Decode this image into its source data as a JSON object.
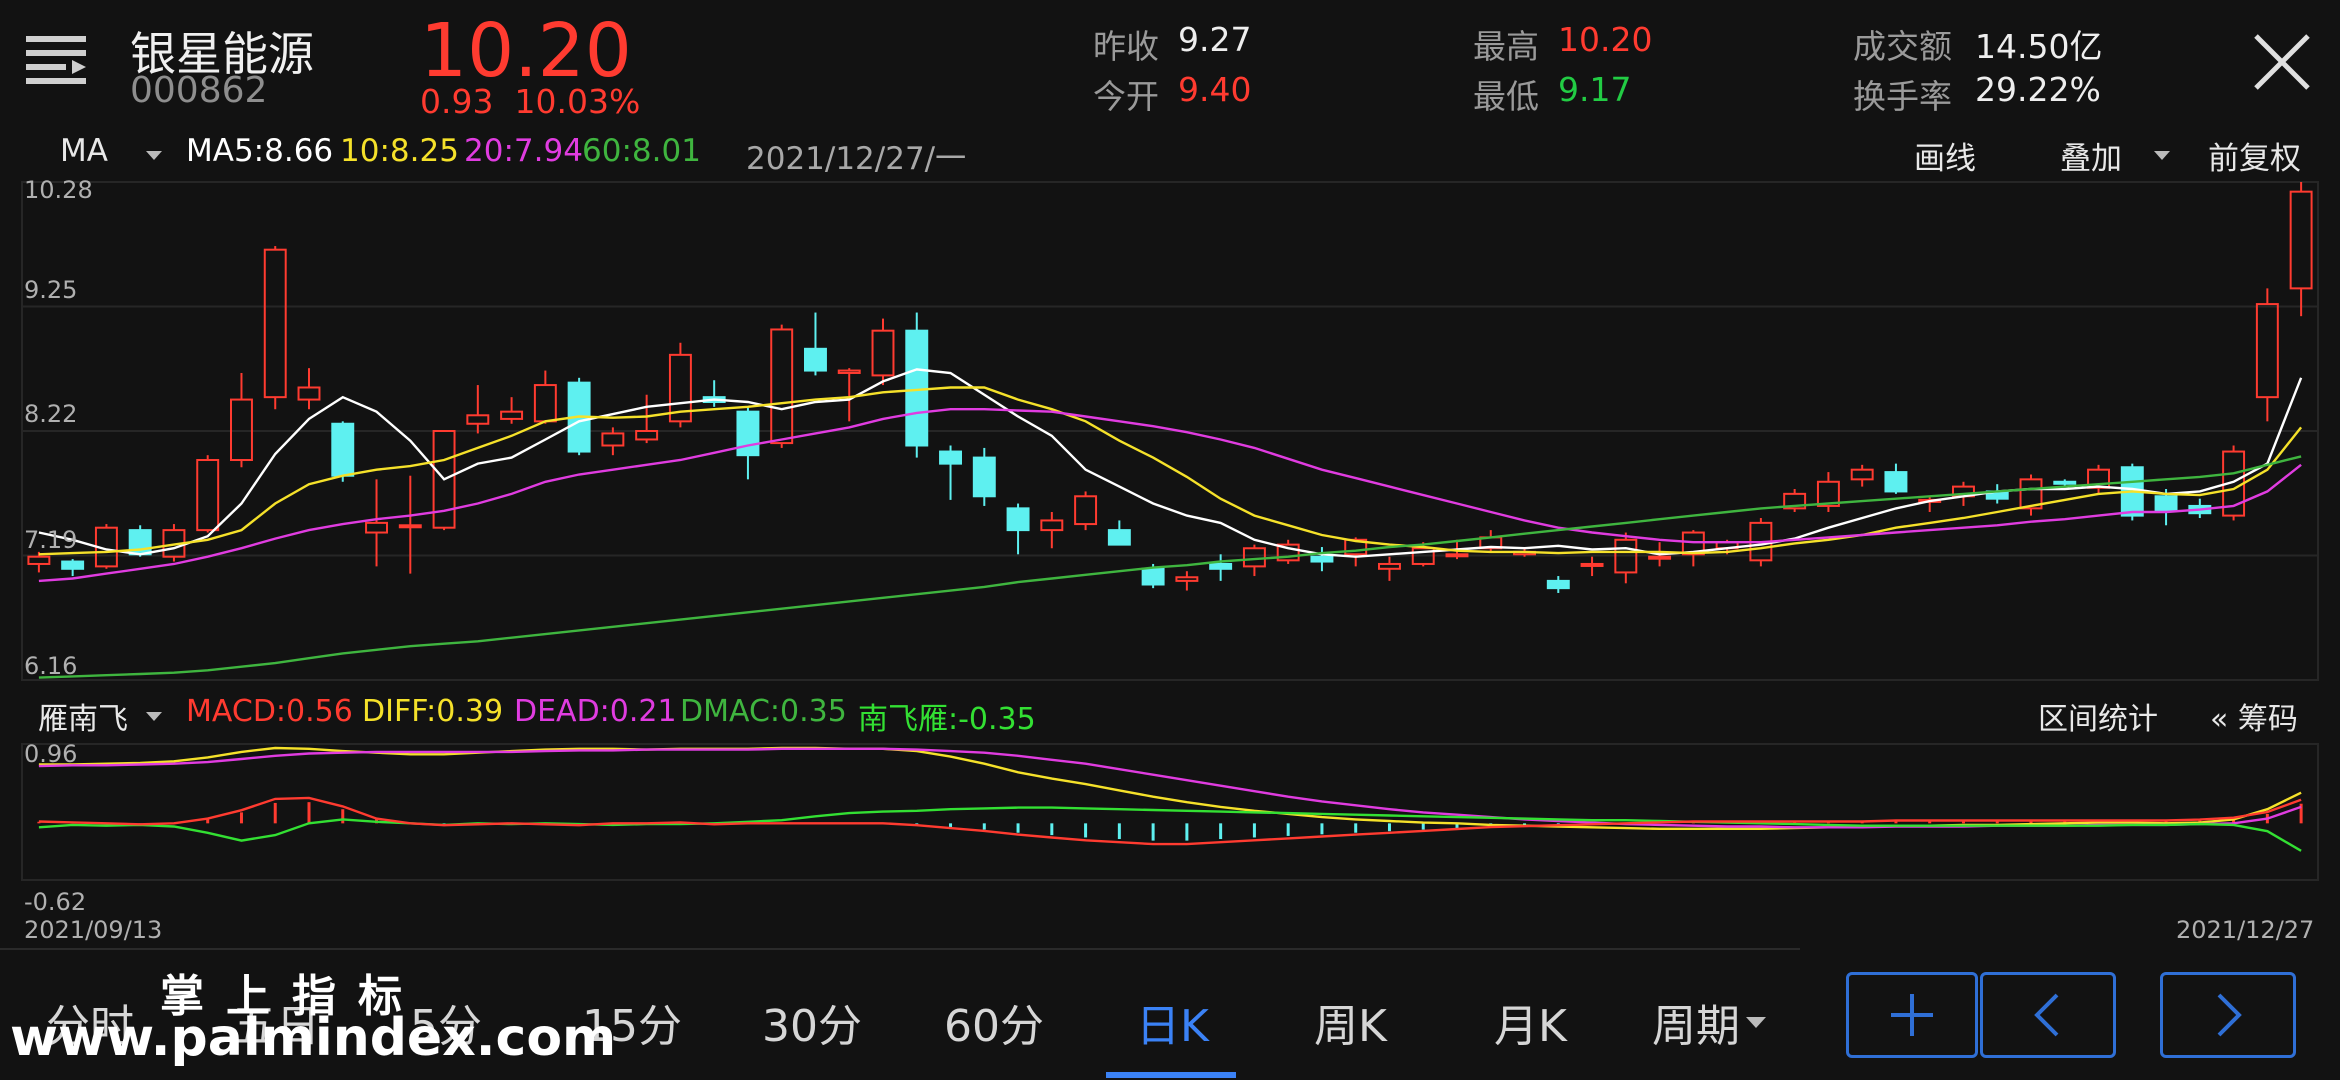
{
  "header": {
    "stock_name": "银星能源",
    "stock_code": "000862",
    "price": "10.20",
    "change": "0.93",
    "change_pct": "10.03%",
    "quotes": [
      {
        "label": "昨收",
        "value": "9.27"
      },
      {
        "label": "今开",
        "value": "9.40"
      },
      {
        "label": "最高",
        "value": "10.20"
      },
      {
        "label": "最低",
        "value": "9.17"
      },
      {
        "label": "成交额",
        "value": "14.50亿"
      },
      {
        "label": "换手率",
        "value": "29.22%"
      }
    ]
  },
  "ma_bar": {
    "selector": "MA",
    "items": [
      {
        "label": "MA5:",
        "value": "8.66",
        "color": "#ffffff"
      },
      {
        "label": "10:",
        "value": "8.25",
        "color": "#f5e12a"
      },
      {
        "label": "20:",
        "value": "7.94",
        "color": "#e03ce0"
      },
      {
        "label": "60:",
        "value": "8.01",
        "color": "#3fb53f"
      }
    ],
    "date": "2021/12/27/一"
  },
  "toolbar": {
    "draw": "画线",
    "overlay": "叠加",
    "adjust": "前复权"
  },
  "indicator_bar": {
    "name": "雁南飞",
    "items": [
      {
        "label": "MACD:",
        "value": "0.56",
        "color": "#ff3b30"
      },
      {
        "label": "DIFF:",
        "value": "0.39",
        "color": "#f5e12a"
      },
      {
        "label": "DEAD:",
        "value": "0.21",
        "color": "#e03ce0"
      },
      {
        "label": "DMAC:",
        "value": "0.35",
        "color": "#3fb53f"
      },
      {
        "label": "南飞雁:",
        "value": "-0.35",
        "color": "#33e033"
      }
    ],
    "range_stats": "区间统计",
    "chips": "« 筹码"
  },
  "axes": {
    "price_ticks": [
      "10.28",
      "9.25",
      "8.22",
      "7.19",
      "6.16"
    ],
    "macd_top": "0.96",
    "macd_bottom": "-0.62",
    "date_start": "2021/09/13",
    "date_end": "2021/12/27"
  },
  "tabs": [
    "分时",
    "五日",
    "5分",
    "15分",
    "30分",
    "60分",
    "日K",
    "周K",
    "月K",
    "周期"
  ],
  "active_tab": "日K",
  "nav_buttons": {
    "add": "+",
    "prev": "‹",
    "next": "›"
  },
  "watermark": {
    "line1": "掌上指标",
    "line2": "www.palmindex.com"
  },
  "colors": {
    "up": "#ff3b30",
    "down": "#5ef0f0",
    "ma5": "#ffffff",
    "ma10": "#f5e12a",
    "ma20": "#e03ce0",
    "ma60": "#3fb53f",
    "accent": "#2f6fd6"
  },
  "chart_data": {
    "type": "candlestick",
    "ylim": [
      6.16,
      10.28
    ],
    "candles_ohlc": [
      [
        7.12,
        7.22,
        7.05,
        7.18
      ],
      [
        7.14,
        7.16,
        7.02,
        7.08
      ],
      [
        7.1,
        7.45,
        7.08,
        7.42
      ],
      [
        7.4,
        7.44,
        7.18,
        7.2
      ],
      [
        7.18,
        7.45,
        7.14,
        7.4
      ],
      [
        7.4,
        8.02,
        7.38,
        7.98
      ],
      [
        7.98,
        8.7,
        7.92,
        8.48
      ],
      [
        8.5,
        9.75,
        8.4,
        9.72
      ],
      [
        8.48,
        8.74,
        8.4,
        8.58
      ],
      [
        8.28,
        8.3,
        7.8,
        7.85
      ],
      [
        7.38,
        7.82,
        7.1,
        7.46
      ],
      [
        7.44,
        7.85,
        7.04,
        7.44
      ],
      [
        7.42,
        8.22,
        7.4,
        8.22
      ],
      [
        8.28,
        8.6,
        8.2,
        8.35
      ],
      [
        8.32,
        8.5,
        8.28,
        8.38
      ],
      [
        8.3,
        8.72,
        8.28,
        8.6
      ],
      [
        8.62,
        8.66,
        8.02,
        8.05
      ],
      [
        8.1,
        8.25,
        8.02,
        8.2
      ],
      [
        8.15,
        8.52,
        8.12,
        8.22
      ],
      [
        8.3,
        8.95,
        8.25,
        8.85
      ],
      [
        8.5,
        8.64,
        8.42,
        8.46
      ],
      [
        8.38,
        8.42,
        7.82,
        8.02
      ],
      [
        8.12,
        9.1,
        8.08,
        9.06
      ],
      [
        8.9,
        9.2,
        8.68,
        8.72
      ],
      [
        8.7,
        8.74,
        8.3,
        8.72
      ],
      [
        8.68,
        9.15,
        8.6,
        9.05
      ],
      [
        9.05,
        9.2,
        8.0,
        8.1
      ],
      [
        8.05,
        8.1,
        7.65,
        7.95
      ],
      [
        8.0,
        8.08,
        7.6,
        7.68
      ],
      [
        7.58,
        7.62,
        7.2,
        7.4
      ],
      [
        7.4,
        7.55,
        7.25,
        7.48
      ],
      [
        7.45,
        7.72,
        7.4,
        7.68
      ],
      [
        7.4,
        7.48,
        7.28,
        7.28
      ],
      [
        7.08,
        7.12,
        6.92,
        6.95
      ],
      [
        6.98,
        7.06,
        6.9,
        7.01
      ],
      [
        7.12,
        7.2,
        6.98,
        7.08
      ],
      [
        7.1,
        7.28,
        7.02,
        7.25
      ],
      [
        7.15,
        7.32,
        7.12,
        7.28
      ],
      [
        7.18,
        7.26,
        7.06,
        7.14
      ],
      [
        7.2,
        7.34,
        7.1,
        7.32
      ],
      [
        7.08,
        7.18,
        6.98,
        7.12
      ],
      [
        7.12,
        7.3,
        7.1,
        7.25
      ],
      [
        7.2,
        7.32,
        7.16,
        7.2
      ],
      [
        7.25,
        7.4,
        7.22,
        7.34
      ],
      [
        7.2,
        7.25,
        7.18,
        7.22
      ],
      [
        6.98,
        7.02,
        6.88,
        6.92
      ],
      [
        7.12,
        7.18,
        7.02,
        7.12
      ],
      [
        7.05,
        7.38,
        6.96,
        7.32
      ],
      [
        7.18,
        7.3,
        7.1,
        7.18
      ],
      [
        7.2,
        7.4,
        7.1,
        7.38
      ],
      [
        7.25,
        7.32,
        7.2,
        7.3
      ],
      [
        7.15,
        7.5,
        7.1,
        7.46
      ],
      [
        7.58,
        7.74,
        7.55,
        7.7
      ],
      [
        7.6,
        7.88,
        7.55,
        7.8
      ],
      [
        7.82,
        7.94,
        7.76,
        7.9
      ],
      [
        7.88,
        7.95,
        7.7,
        7.72
      ],
      [
        7.64,
        7.68,
        7.55,
        7.65
      ],
      [
        7.68,
        7.8,
        7.6,
        7.76
      ],
      [
        7.72,
        7.78,
        7.62,
        7.66
      ],
      [
        7.58,
        7.86,
        7.52,
        7.82
      ],
      [
        7.8,
        7.82,
        7.76,
        7.79
      ],
      [
        7.75,
        7.94,
        7.7,
        7.9
      ],
      [
        7.92,
        7.95,
        7.48,
        7.52
      ],
      [
        7.68,
        7.74,
        7.44,
        7.56
      ],
      [
        7.6,
        7.66,
        7.5,
        7.54
      ],
      [
        7.52,
        8.1,
        7.48,
        8.05
      ],
      [
        8.5,
        9.4,
        8.3,
        9.27
      ],
      [
        9.4,
        10.28,
        9.17,
        10.2
      ]
    ],
    "series": [
      {
        "name": "MA5",
        "values": [
          7.38,
          7.32,
          7.24,
          7.2,
          7.25,
          7.35,
          7.62,
          8.03,
          8.32,
          8.5,
          8.38,
          8.14,
          7.82,
          7.95,
          8.0,
          8.15,
          8.3,
          8.36,
          8.42,
          8.45,
          8.48,
          8.46,
          8.4,
          8.46,
          8.48,
          8.63,
          8.73,
          8.7,
          8.52,
          8.34,
          8.18,
          7.9,
          7.76,
          7.62,
          7.52,
          7.46,
          7.32,
          7.25,
          7.2,
          7.18,
          7.2,
          7.22,
          7.24,
          7.26,
          7.25,
          7.27,
          7.24,
          7.25,
          7.2,
          7.22,
          7.25,
          7.28,
          7.33,
          7.42,
          7.5,
          7.58,
          7.64,
          7.68,
          7.72,
          7.74,
          7.74,
          7.76,
          7.74,
          7.7,
          7.72,
          7.8,
          7.95,
          8.66
        ]
      },
      {
        "name": "10",
        "values": [
          7.2,
          7.21,
          7.22,
          7.24,
          7.28,
          7.32,
          7.4,
          7.62,
          7.78,
          7.85,
          7.9,
          7.93,
          7.98,
          8.08,
          8.18,
          8.3,
          8.34,
          8.33,
          8.34,
          8.38,
          8.4,
          8.42,
          8.45,
          8.48,
          8.5,
          8.54,
          8.56,
          8.58,
          8.58,
          8.48,
          8.4,
          8.3,
          8.14,
          8.0,
          7.84,
          7.66,
          7.52,
          7.44,
          7.36,
          7.31,
          7.28,
          7.26,
          7.23,
          7.22,
          7.22,
          7.21,
          7.22,
          7.22,
          7.22,
          7.21,
          7.22,
          7.25,
          7.29,
          7.32,
          7.36,
          7.42,
          7.46,
          7.5,
          7.55,
          7.6,
          7.65,
          7.7,
          7.72,
          7.7,
          7.69,
          7.74,
          7.9,
          8.25
        ]
      },
      {
        "name": "20",
        "values": [
          6.98,
          7.0,
          7.04,
          7.08,
          7.12,
          7.18,
          7.25,
          7.33,
          7.4,
          7.45,
          7.49,
          7.52,
          7.56,
          7.62,
          7.7,
          7.8,
          7.86,
          7.9,
          7.94,
          7.98,
          8.04,
          8.1,
          8.15,
          8.2,
          8.25,
          8.32,
          8.37,
          8.4,
          8.4,
          8.39,
          8.38,
          8.34,
          8.3,
          8.26,
          8.21,
          8.15,
          8.08,
          7.99,
          7.9,
          7.83,
          7.76,
          7.69,
          7.62,
          7.55,
          7.48,
          7.42,
          7.38,
          7.35,
          7.32,
          7.3,
          7.3,
          7.3,
          7.32,
          7.34,
          7.36,
          7.38,
          7.4,
          7.42,
          7.44,
          7.47,
          7.49,
          7.52,
          7.55,
          7.55,
          7.57,
          7.6,
          7.72,
          7.94
        ]
      },
      {
        "name": "60",
        "values": [
          6.18,
          6.19,
          6.2,
          6.21,
          6.22,
          6.24,
          6.27,
          6.3,
          6.34,
          6.38,
          6.41,
          6.44,
          6.46,
          6.48,
          6.51,
          6.54,
          6.57,
          6.6,
          6.63,
          6.66,
          6.69,
          6.72,
          6.75,
          6.78,
          6.81,
          6.84,
          6.87,
          6.9,
          6.93,
          6.97,
          7.0,
          7.03,
          7.06,
          7.09,
          7.11,
          7.14,
          7.16,
          7.18,
          7.21,
          7.23,
          7.26,
          7.28,
          7.31,
          7.34,
          7.37,
          7.4,
          7.43,
          7.46,
          7.49,
          7.52,
          7.55,
          7.58,
          7.6,
          7.62,
          7.64,
          7.66,
          7.68,
          7.7,
          7.72,
          7.74,
          7.76,
          7.78,
          7.8,
          7.82,
          7.84,
          7.87,
          7.94,
          8.01
        ]
      }
    ],
    "macd": {
      "ylim": [
        -0.62,
        0.96
      ],
      "bars": [
        0.02,
        0.01,
        0.0,
        -0.01,
        0.0,
        0.05,
        0.14,
        0.26,
        0.27,
        0.18,
        0.05,
        0.0,
        -0.02,
        -0.01,
        0.0,
        -0.01,
        -0.02,
        0.0,
        0.0,
        0.01,
        -0.01,
        0.0,
        0.0,
        0.0,
        0.0,
        0.0,
        -0.02,
        -0.05,
        -0.08,
        -0.12,
        -0.15,
        -0.18,
        -0.2,
        -0.22,
        -0.22,
        -0.2,
        -0.18,
        -0.16,
        -0.14,
        -0.12,
        -0.1,
        -0.08,
        -0.06,
        -0.04,
        -0.03,
        -0.02,
        -0.01,
        0.0,
        0.01,
        0.02,
        0.02,
        0.02,
        0.02,
        0.02,
        0.02,
        0.03,
        0.03,
        0.03,
        0.03,
        0.03,
        0.03,
        0.03,
        0.03,
        0.03,
        0.04,
        0.06,
        0.12,
        0.25
      ],
      "diff": [
        0.75,
        0.75,
        0.76,
        0.77,
        0.79,
        0.84,
        0.91,
        0.96,
        0.95,
        0.92,
        0.9,
        0.88,
        0.88,
        0.9,
        0.92,
        0.94,
        0.95,
        0.95,
        0.94,
        0.95,
        0.95,
        0.95,
        0.96,
        0.96,
        0.95,
        0.95,
        0.92,
        0.85,
        0.76,
        0.65,
        0.57,
        0.5,
        0.42,
        0.34,
        0.27,
        0.21,
        0.16,
        0.12,
        0.08,
        0.05,
        0.03,
        0.01,
        0.0,
        -0.02,
        -0.03,
        -0.04,
        -0.05,
        -0.06,
        -0.07,
        -0.07,
        -0.07,
        -0.07,
        -0.06,
        -0.05,
        -0.04,
        -0.03,
        -0.03,
        -0.02,
        -0.02,
        -0.01,
        0.0,
        0.01,
        0.01,
        0.0,
        0.01,
        0.05,
        0.18,
        0.39
      ],
      "dea": [
        0.73,
        0.74,
        0.74,
        0.75,
        0.76,
        0.78,
        0.82,
        0.86,
        0.89,
        0.9,
        0.91,
        0.91,
        0.91,
        0.91,
        0.91,
        0.92,
        0.93,
        0.93,
        0.94,
        0.94,
        0.94,
        0.94,
        0.95,
        0.95,
        0.95,
        0.95,
        0.94,
        0.92,
        0.9,
        0.86,
        0.81,
        0.76,
        0.69,
        0.62,
        0.55,
        0.48,
        0.41,
        0.34,
        0.28,
        0.23,
        0.18,
        0.14,
        0.11,
        0.08,
        0.05,
        0.03,
        0.01,
        -0.01,
        -0.02,
        -0.03,
        -0.04,
        -0.04,
        -0.05,
        -0.05,
        -0.05,
        -0.04,
        -0.04,
        -0.04,
        -0.03,
        -0.03,
        -0.03,
        -0.02,
        -0.02,
        -0.02,
        -0.01,
        0.0,
        0.06,
        0.21
      ],
      "dmac": [
        -0.05,
        -0.02,
        -0.03,
        -0.02,
        -0.04,
        -0.12,
        -0.22,
        -0.15,
        0.0,
        0.05,
        0.02,
        0.0,
        -0.02,
        0.0,
        -0.01,
        0.0,
        -0.01,
        -0.02,
        -0.01,
        -0.01,
        0.0,
        0.02,
        0.04,
        0.09,
        0.13,
        0.15,
        0.16,
        0.18,
        0.19,
        0.2,
        0.2,
        0.19,
        0.18,
        0.17,
        0.16,
        0.15,
        0.14,
        0.13,
        0.12,
        0.11,
        0.1,
        0.09,
        0.08,
        0.07,
        0.06,
        0.05,
        0.04,
        0.04,
        0.03,
        0.02,
        0.01,
        0.0,
        -0.01,
        -0.02,
        -0.03,
        -0.03,
        -0.03,
        -0.03,
        -0.03,
        -0.03,
        -0.03,
        -0.03,
        -0.02,
        -0.02,
        -0.01,
        -0.02,
        -0.1,
        -0.35
      ]
    }
  }
}
